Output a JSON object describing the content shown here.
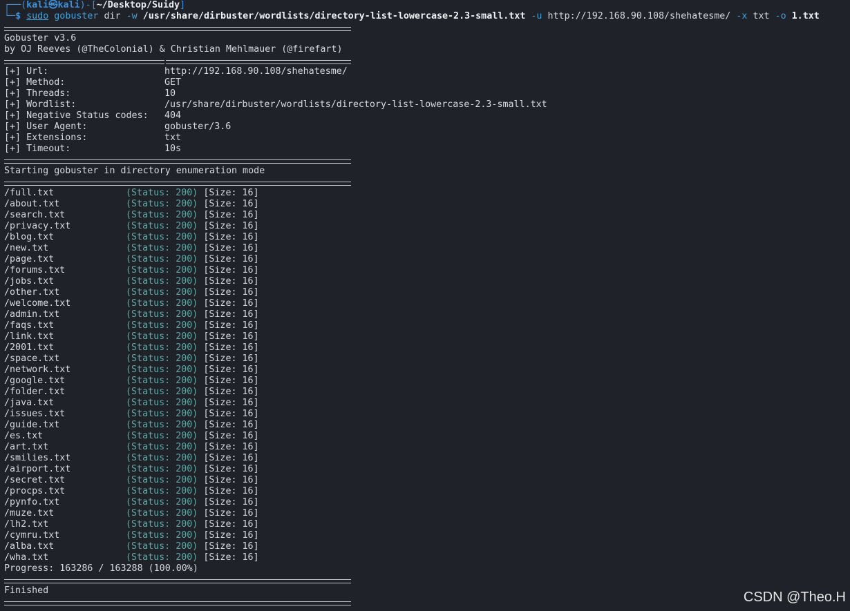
{
  "prompt": {
    "box_top": "┌──(",
    "user": "kali㉿kali",
    "close_user": ")-[",
    "cwd": "~/Desktop/Suidy",
    "close_cwd": "]",
    "box_bottom": "└─",
    "dollar": "$",
    "sudo": "sudo",
    "cmd": "gobuster",
    "subcmd": "dir",
    "flag_w": "-w",
    "wordlist": "/usr/share/dirbuster/wordlists/directory-list-lowercase-2.3-small.txt",
    "flag_u": "-u",
    "url": "http://192.168.90.108/shehatesme/",
    "flag_x": "-x",
    "ext": "txt",
    "flag_o": "-o",
    "outfile": "1.txt"
  },
  "banner": {
    "title": "Gobuster v3.6",
    "authors": "by OJ Reeves (@TheColonial) & Christian Mehlmauer (@firefart)"
  },
  "config": [
    {
      "key": "[+] Url:",
      "value": "http://192.168.90.108/shehatesme/"
    },
    {
      "key": "[+] Method:",
      "value": "GET"
    },
    {
      "key": "[+] Threads:",
      "value": "10"
    },
    {
      "key": "[+] Wordlist:",
      "value": "/usr/share/dirbuster/wordlists/directory-list-lowercase-2.3-small.txt"
    },
    {
      "key": "[+] Negative Status codes:",
      "value": "404"
    },
    {
      "key": "[+] User Agent:",
      "value": "gobuster/3.6"
    },
    {
      "key": "[+] Extensions:",
      "value": "txt"
    },
    {
      "key": "[+] Timeout:",
      "value": "10s"
    }
  ],
  "start_message": "Starting gobuster in directory enumeration mode",
  "results": [
    {
      "path": "/full.txt",
      "status": "(Status: 200)",
      "size": "[Size: 16]"
    },
    {
      "path": "/about.txt",
      "status": "(Status: 200)",
      "size": "[Size: 16]"
    },
    {
      "path": "/search.txt",
      "status": "(Status: 200)",
      "size": "[Size: 16]"
    },
    {
      "path": "/privacy.txt",
      "status": "(Status: 200)",
      "size": "[Size: 16]"
    },
    {
      "path": "/blog.txt",
      "status": "(Status: 200)",
      "size": "[Size: 16]"
    },
    {
      "path": "/new.txt",
      "status": "(Status: 200)",
      "size": "[Size: 16]"
    },
    {
      "path": "/page.txt",
      "status": "(Status: 200)",
      "size": "[Size: 16]"
    },
    {
      "path": "/forums.txt",
      "status": "(Status: 200)",
      "size": "[Size: 16]"
    },
    {
      "path": "/jobs.txt",
      "status": "(Status: 200)",
      "size": "[Size: 16]"
    },
    {
      "path": "/other.txt",
      "status": "(Status: 200)",
      "size": "[Size: 16]"
    },
    {
      "path": "/welcome.txt",
      "status": "(Status: 200)",
      "size": "[Size: 16]"
    },
    {
      "path": "/admin.txt",
      "status": "(Status: 200)",
      "size": "[Size: 16]"
    },
    {
      "path": "/faqs.txt",
      "status": "(Status: 200)",
      "size": "[Size: 16]"
    },
    {
      "path": "/link.txt",
      "status": "(Status: 200)",
      "size": "[Size: 16]"
    },
    {
      "path": "/2001.txt",
      "status": "(Status: 200)",
      "size": "[Size: 16]"
    },
    {
      "path": "/space.txt",
      "status": "(Status: 200)",
      "size": "[Size: 16]"
    },
    {
      "path": "/network.txt",
      "status": "(Status: 200)",
      "size": "[Size: 16]"
    },
    {
      "path": "/google.txt",
      "status": "(Status: 200)",
      "size": "[Size: 16]"
    },
    {
      "path": "/folder.txt",
      "status": "(Status: 200)",
      "size": "[Size: 16]"
    },
    {
      "path": "/java.txt",
      "status": "(Status: 200)",
      "size": "[Size: 16]"
    },
    {
      "path": "/issues.txt",
      "status": "(Status: 200)",
      "size": "[Size: 16]"
    },
    {
      "path": "/guide.txt",
      "status": "(Status: 200)",
      "size": "[Size: 16]"
    },
    {
      "path": "/es.txt",
      "status": "(Status: 200)",
      "size": "[Size: 16]"
    },
    {
      "path": "/art.txt",
      "status": "(Status: 200)",
      "size": "[Size: 16]"
    },
    {
      "path": "/smilies.txt",
      "status": "(Status: 200)",
      "size": "[Size: 16]"
    },
    {
      "path": "/airport.txt",
      "status": "(Status: 200)",
      "size": "[Size: 16]"
    },
    {
      "path": "/secret.txt",
      "status": "(Status: 200)",
      "size": "[Size: 16]"
    },
    {
      "path": "/procps.txt",
      "status": "(Status: 200)",
      "size": "[Size: 16]"
    },
    {
      "path": "/pynfo.txt",
      "status": "(Status: 200)",
      "size": "[Size: 16]"
    },
    {
      "path": "/muze.txt",
      "status": "(Status: 200)",
      "size": "[Size: 16]"
    },
    {
      "path": "/lh2.txt",
      "status": "(Status: 200)",
      "size": "[Size: 16]"
    },
    {
      "path": "/cymru.txt",
      "status": "(Status: 200)",
      "size": "[Size: 16]"
    },
    {
      "path": "/alba.txt",
      "status": "(Status: 200)",
      "size": "[Size: 16]"
    },
    {
      "path": "/wha.txt",
      "status": "(Status: 200)",
      "size": "[Size: 16]"
    }
  ],
  "progress": "Progress: 163286 / 163288 (100.00%)",
  "finished": "Finished",
  "watermark": "CSDN @Theo.H"
}
